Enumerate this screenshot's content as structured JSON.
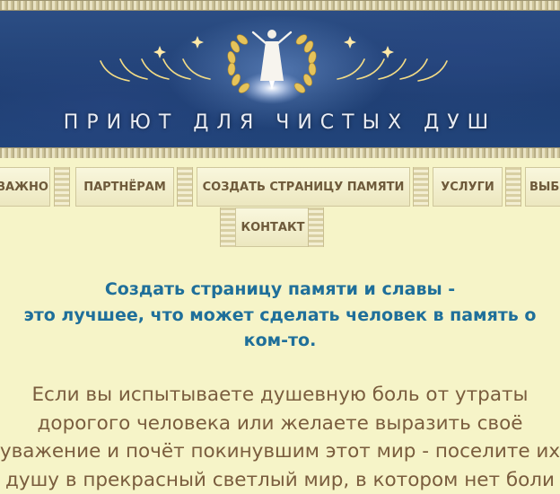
{
  "header": {
    "site_title": "ПРИЮТ ДЛЯ ЧИСТЫХ ДУШ",
    "logo": "angel-laurel-wreath-logo"
  },
  "nav": {
    "items": [
      {
        "label": "ВАЖНО"
      },
      {
        "label": "ПАРТНЁРАМ"
      },
      {
        "label": "СОЗДАТЬ СТРАНИЦУ ПАМЯТИ"
      },
      {
        "label": "УСЛУГИ"
      },
      {
        "label": "ВЫБ"
      },
      {
        "label": "КОНТАКТ"
      }
    ]
  },
  "content": {
    "lead_line1": "Создать страницу памяти и славы -",
    "lead_line2": "это лучшее, что может сделать человек в память о",
    "lead_line3": "ком-то.",
    "body_line1": "Если вы испытываете душевную боль от утраты",
    "body_line2": "дорогого человека или желаете выразить своё",
    "body_line3": "уважение и почёт покинувшим этот мир - поселите их",
    "body_line4": "душу в прекрасный светлый мир, в котором нет боли"
  },
  "colors": {
    "page_bg": "#f6f4c8",
    "banner_blue": "#22457c",
    "lead_text": "#1f6f9a",
    "body_text": "#7a5d3e",
    "nav_text": "#6e5a3a"
  }
}
